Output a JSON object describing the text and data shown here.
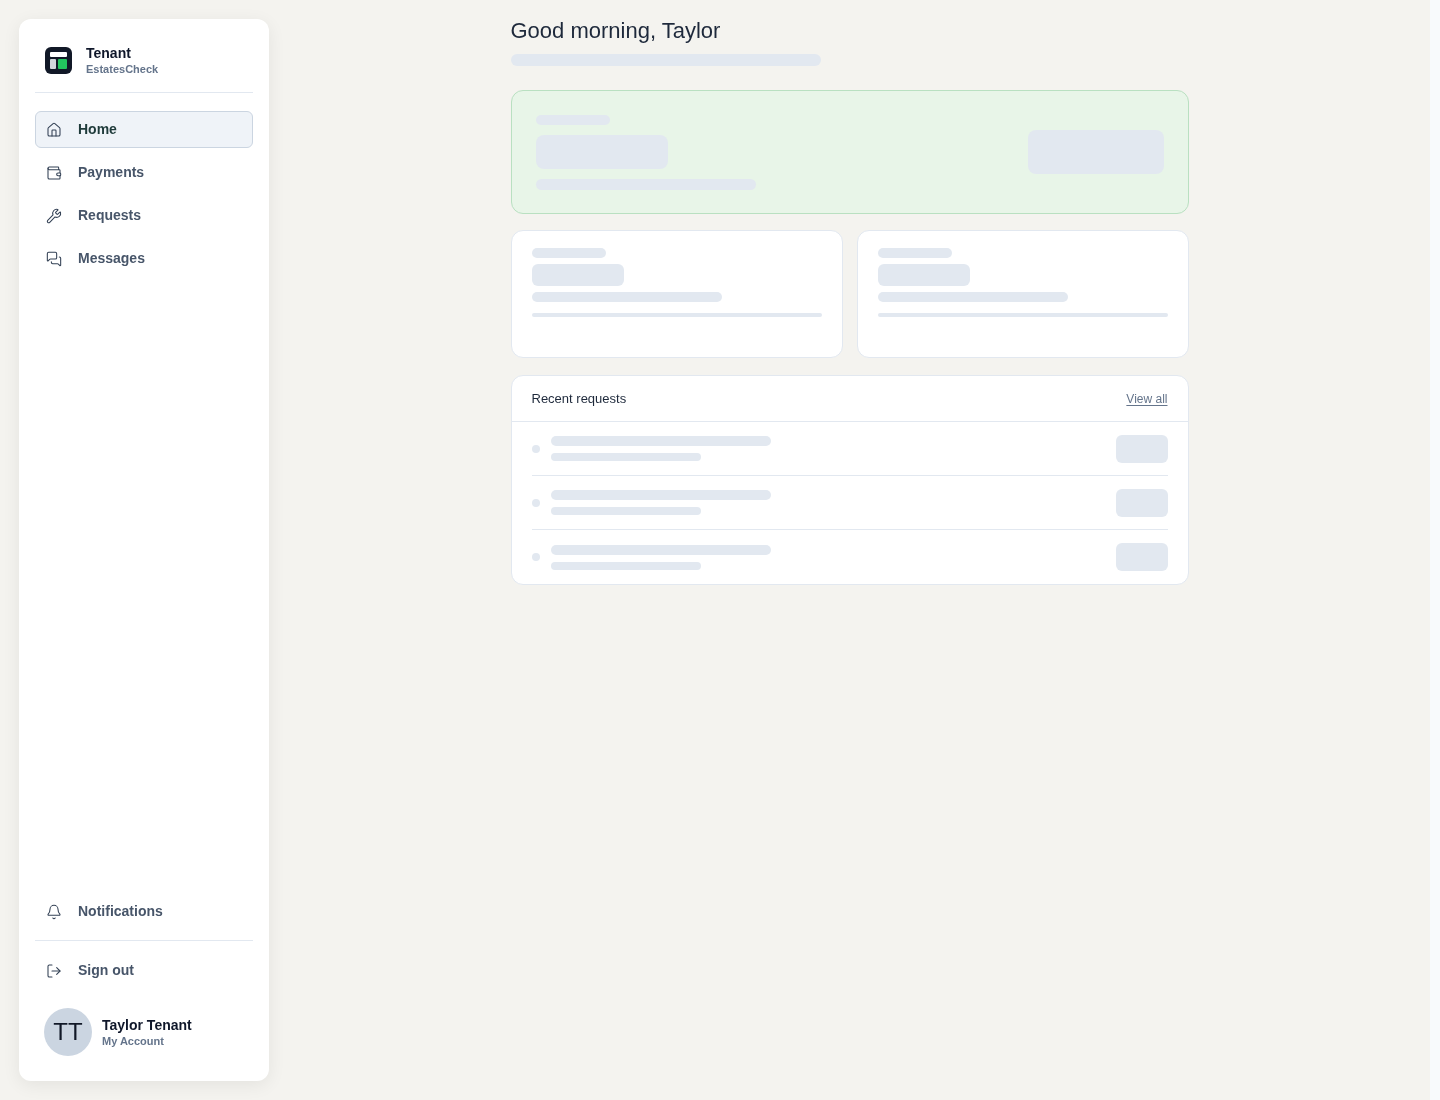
{
  "sidebar": {
    "brand": {
      "title": "Tenant",
      "subtitle": "EstatesCheck"
    },
    "nav": [
      {
        "label": "Home",
        "selected": true
      },
      {
        "label": "Payments",
        "selected": false
      },
      {
        "label": "Requests",
        "selected": false
      },
      {
        "label": "Messages",
        "selected": false
      }
    ],
    "footer_nav": [
      {
        "label": "Notifications"
      },
      {
        "label": "Sign out"
      }
    ],
    "account": {
      "initials": "TT",
      "name": "Taylor Tenant",
      "subtitle": "My Account"
    }
  },
  "main": {
    "greeting": "Good morning, Taylor",
    "loading": true,
    "recent_requests": {
      "title": "Recent requests",
      "link": "View all"
    }
  }
}
